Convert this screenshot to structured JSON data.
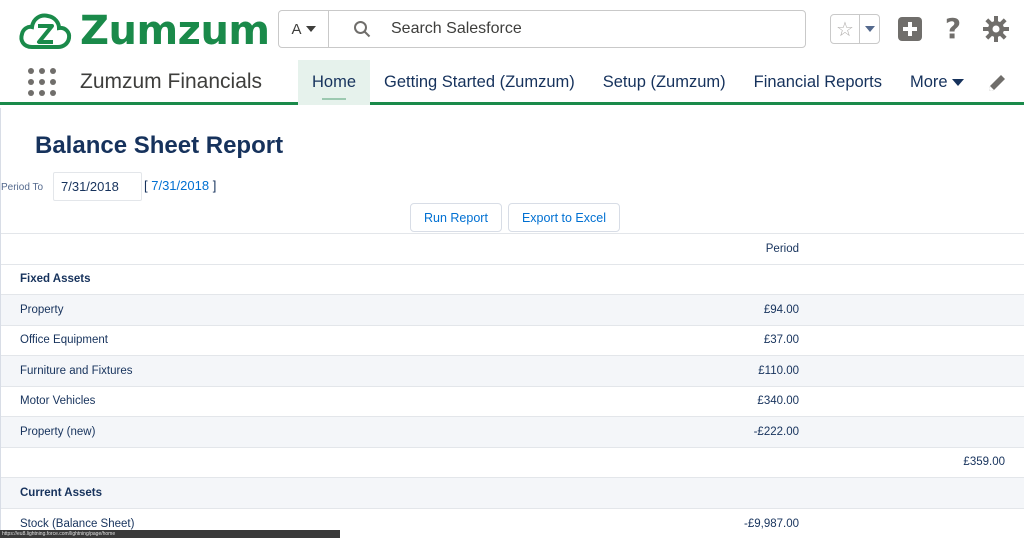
{
  "brand": {
    "name": "Zumzum",
    "color": "#1a8a4a"
  },
  "search": {
    "scope_label": "A",
    "placeholder": "Search Salesforce"
  },
  "header_icons": [
    "star-icon",
    "chevron-down-icon",
    "plus-icon",
    "help-icon",
    "gear-icon"
  ],
  "nav": {
    "app_name": "Zumzum Financials",
    "items": [
      {
        "label": "Home",
        "active": true
      },
      {
        "label": "Getting Started (Zumzum)",
        "active": false
      },
      {
        "label": "Setup (Zumzum)",
        "active": false
      },
      {
        "label": "Financial Reports",
        "active": false
      }
    ],
    "more_label": "More"
  },
  "report": {
    "title": "Balance Sheet Report",
    "period_label": "Period To",
    "period_value": "7/31/2018",
    "period_link_open": "[ ",
    "period_link": "7/31/2018",
    "period_link_close": " ]",
    "run_button": "Run Report",
    "export_button": "Export to Excel",
    "column_header": "Period",
    "rows": [
      {
        "label": "Fixed Assets",
        "period": "",
        "total": "",
        "type": "section"
      },
      {
        "label": "Property",
        "period": "£94.00",
        "total": "",
        "type": "item"
      },
      {
        "label": "Office Equipment",
        "period": "£37.00",
        "total": "",
        "type": "item"
      },
      {
        "label": "Furniture and Fixtures",
        "period": "£110.00",
        "total": "",
        "type": "item"
      },
      {
        "label": "Motor Vehicles",
        "period": "£340.00",
        "total": "",
        "type": "item"
      },
      {
        "label": "Property (new)",
        "period": "-£222.00",
        "total": "",
        "type": "item"
      },
      {
        "label": "",
        "period": "",
        "total": "£359.00",
        "type": "subtotal"
      },
      {
        "label": "Current Assets",
        "period": "",
        "total": "",
        "type": "section"
      },
      {
        "label": "Stock (Balance Sheet)",
        "period": "-£9,987.00",
        "total": "",
        "type": "item"
      }
    ]
  },
  "status_bar": {
    "url": "https://eu8.lightning.force.com/lightning/page/home"
  }
}
